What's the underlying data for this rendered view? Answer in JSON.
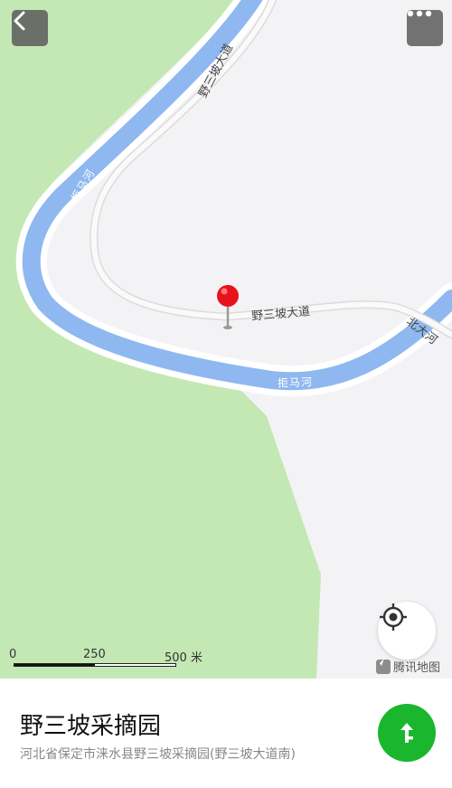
{
  "map": {
    "roads": [
      {
        "name": "野三坡大道"
      },
      {
        "name": "野三坡大道"
      },
      {
        "name": "北大河"
      }
    ],
    "rivers": [
      {
        "name": "拒马河"
      },
      {
        "name": "拒马河"
      }
    ],
    "colors": {
      "land": "#f3f3f5",
      "green_area": "#c3e8b4",
      "river": "#8fb8f0",
      "road_outline": "#dcdcdc",
      "pin": "#e8121b"
    },
    "marker": {
      "icon": "red-map-pin"
    }
  },
  "top_bar": {
    "back_icon": "chevron-left",
    "more_icon": "ellipsis"
  },
  "scale_bar": {
    "ticks": [
      "0",
      "250",
      "500 米"
    ]
  },
  "locate": {
    "icon": "locate-crosshair"
  },
  "attribution": {
    "text": "腾讯地图"
  },
  "place": {
    "name": "野三坡采摘园",
    "address": "河北省保定市涞水县野三坡采摘园(野三坡大道南)"
  },
  "navigate": {
    "icon": "navigation-arrow",
    "color": "#19b62e"
  }
}
